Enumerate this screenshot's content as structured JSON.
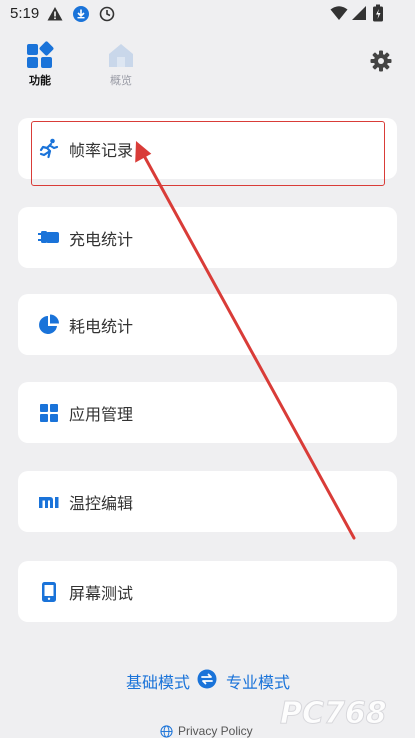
{
  "status_bar": {
    "time": "5:19",
    "icons": [
      "warning-icon",
      "download-icon",
      "clock-icon",
      "wifi-icon",
      "signal-icon",
      "battery-icon"
    ]
  },
  "tabs": [
    {
      "label": "功能",
      "icon": "feature-icon",
      "selected": true
    },
    {
      "label": "概览",
      "icon": "overview-icon",
      "selected": false
    }
  ],
  "settings": {
    "icon": "gear-icon"
  },
  "menu": [
    {
      "label": "帧率记录",
      "icon": "running-icon",
      "highlighted": true
    },
    {
      "label": "充电统计",
      "icon": "plug-icon"
    },
    {
      "label": "耗电统计",
      "icon": "pie-icon"
    },
    {
      "label": "应用管理",
      "icon": "grid-icon"
    },
    {
      "label": "温控编辑",
      "icon": "mi-logo-icon"
    },
    {
      "label": "屏幕测试",
      "icon": "phone-icon"
    }
  ],
  "mode_switch": {
    "basic_label": "基础模式",
    "pro_label": "专业模式",
    "icon": "swap-icon"
  },
  "privacy": {
    "label": "Privacy Policy",
    "icon": "globe-icon"
  },
  "watermark": {
    "text": "PC768"
  },
  "colors": {
    "accent": "#1a73d9",
    "annotation": "#d93c38",
    "background": "#efeff1"
  }
}
